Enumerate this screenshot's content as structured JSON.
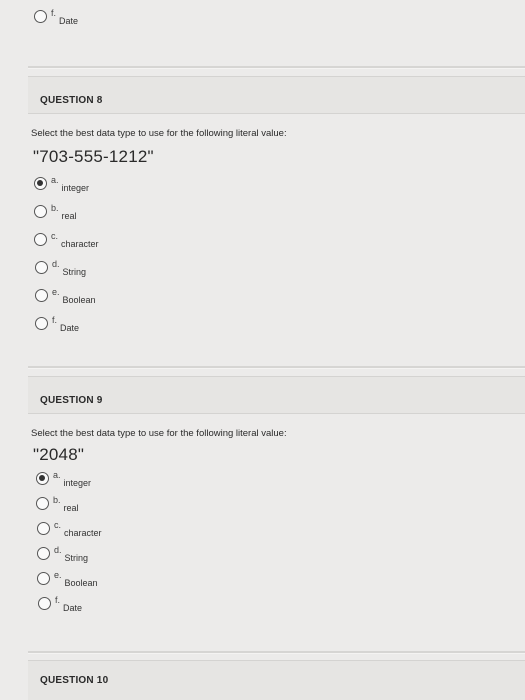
{
  "prev_question_tail": {
    "option": {
      "letter": "f.",
      "text": "Date"
    }
  },
  "questions": [
    {
      "title": "QUESTION 8",
      "prompt": "Select the best data type to use for the following literal value:",
      "literal": "\"703-555-1212\"",
      "options": [
        {
          "letter": "a.",
          "text": "integer",
          "selected": true
        },
        {
          "letter": "b.",
          "text": "real",
          "selected": false
        },
        {
          "letter": "c.",
          "text": "character",
          "selected": false
        },
        {
          "letter": "d.",
          "text": "String",
          "selected": false
        },
        {
          "letter": "e.",
          "text": "Boolean",
          "selected": false
        },
        {
          "letter": "f.",
          "text": "Date",
          "selected": false
        }
      ]
    },
    {
      "title": "QUESTION 9",
      "prompt": "Select the best data type to use for the following literal value:",
      "literal": "\"2048\"",
      "options": [
        {
          "letter": "a.",
          "text": "integer",
          "selected": true
        },
        {
          "letter": "b.",
          "text": "real",
          "selected": false
        },
        {
          "letter": "c.",
          "text": "character",
          "selected": false
        },
        {
          "letter": "d.",
          "text": "String",
          "selected": false
        },
        {
          "letter": "e.",
          "text": "Boolean",
          "selected": false
        },
        {
          "letter": "f.",
          "text": "Date",
          "selected": false
        }
      ]
    },
    {
      "title": "QUESTION 10"
    }
  ]
}
